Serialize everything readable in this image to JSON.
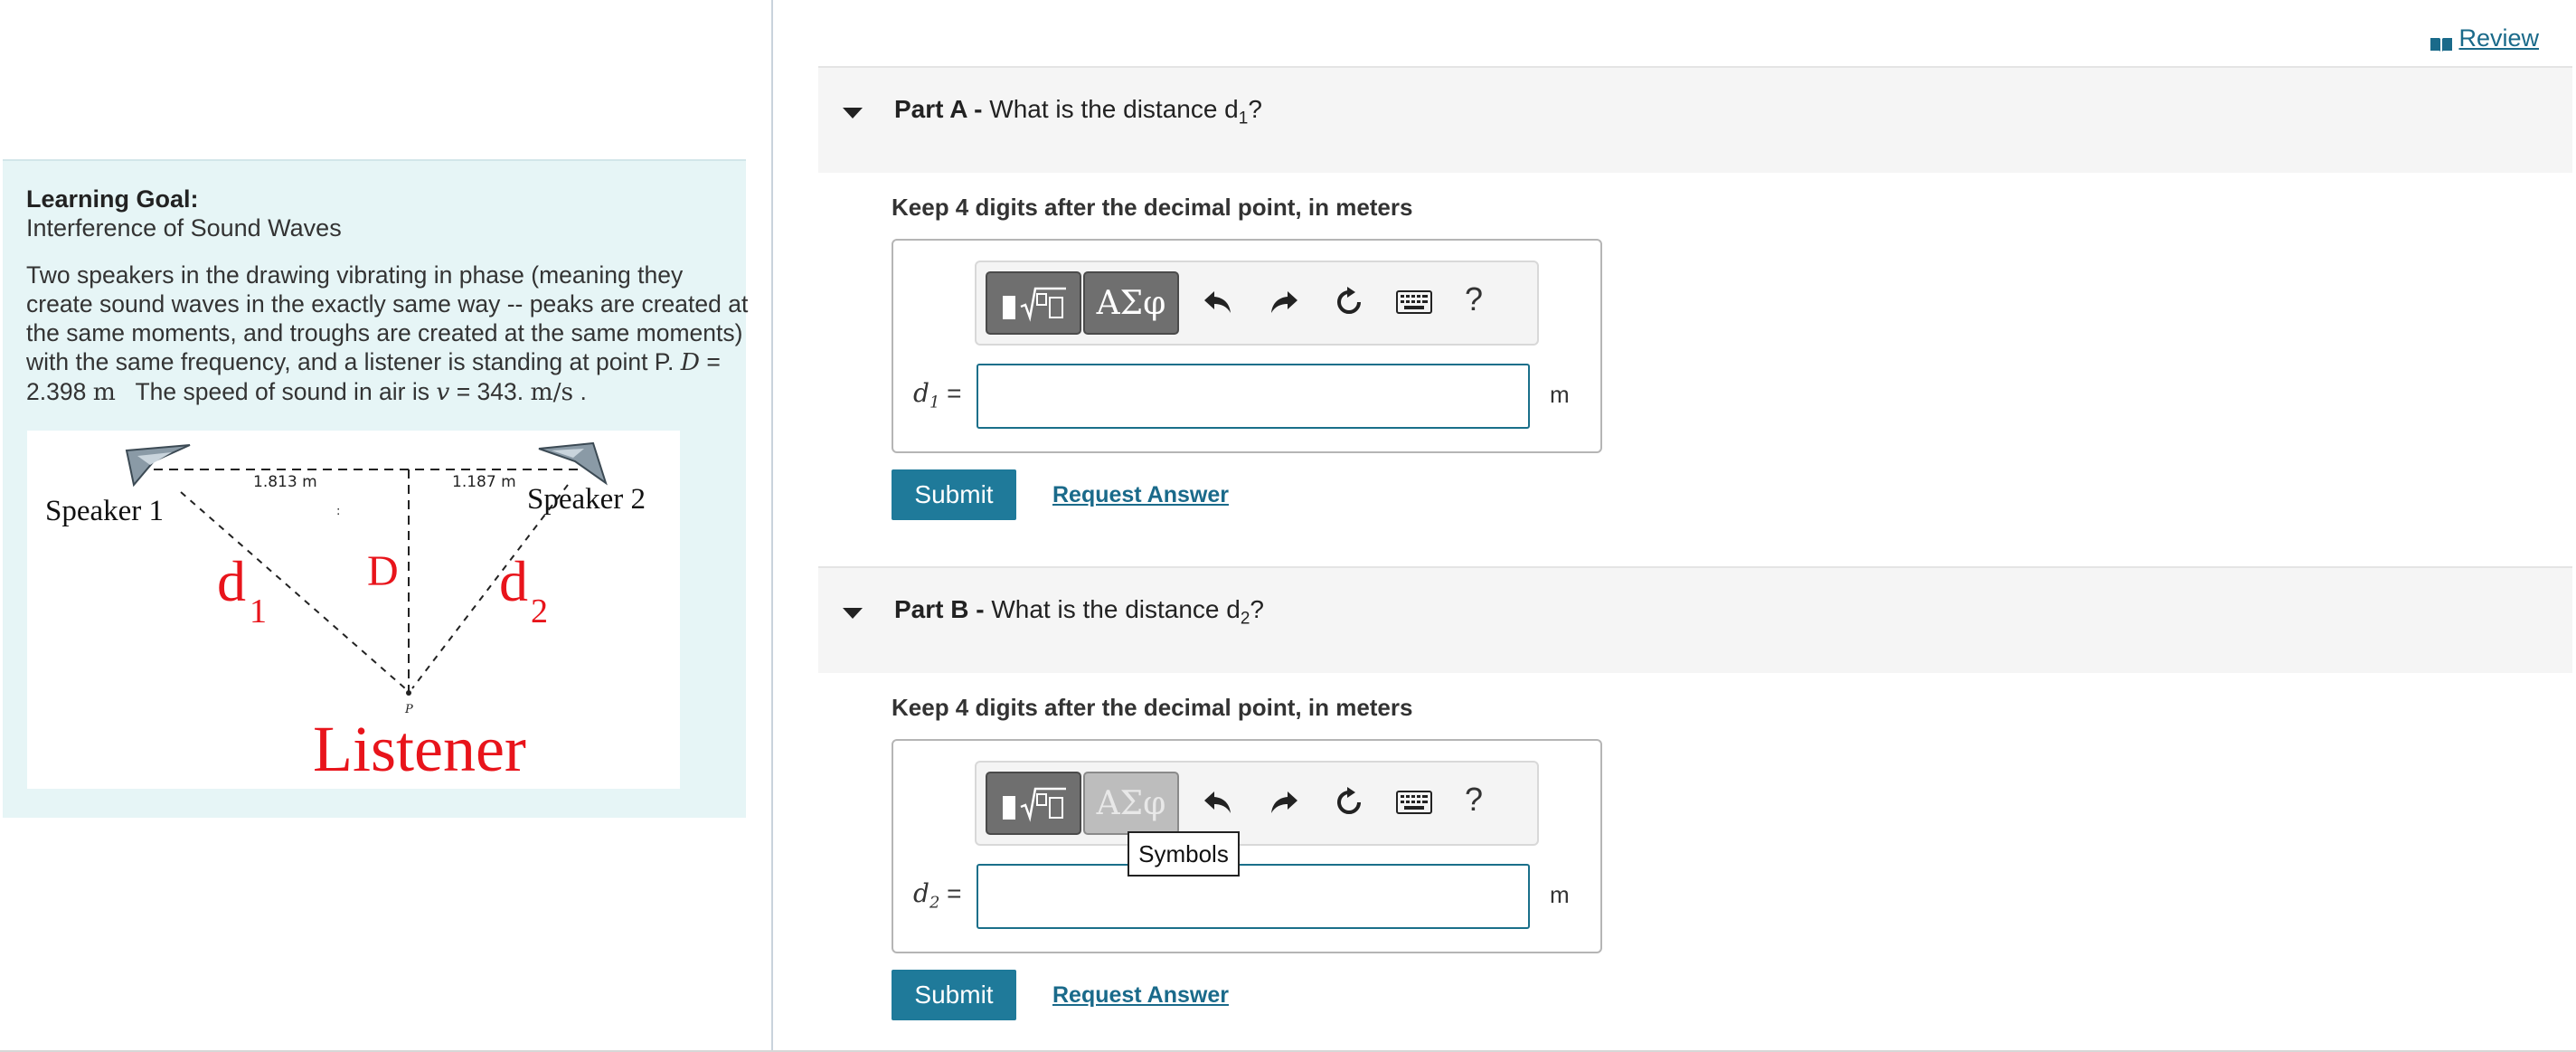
{
  "header": {
    "review_label": "Review"
  },
  "learning_goal": {
    "title": "Learning Goal:",
    "subtitle": "Interference of Sound Waves",
    "text_intro": "Two speakers in the drawing vibrating in phase (meaning they create sound waves in the exactly same way -- peaks are created at the same moments, and troughs are created at the same moments) with the same frequency, and a listener is standing at point P.",
    "D_symbol": "D",
    "D_eq": " = 2.398 ",
    "D_unit": "m",
    "speed_text": "The speed of sound in air is ",
    "v_symbol": "v",
    "v_eq": " = 343. ",
    "v_unit": "m/s",
    "end_period": " ."
  },
  "figure": {
    "speaker1": "Speaker 1",
    "speaker2": "Speaker 2",
    "dist_left": "1.813 m",
    "dist_right": "1.187 m",
    "label_d1": "d",
    "label_d1_sub": "1",
    "label_d2": "d",
    "label_d2_sub": "2",
    "label_D": "D",
    "label_P": "P",
    "listener": "Listener"
  },
  "part_a": {
    "label": "Part A -",
    "question_pre": "What is the distance d",
    "question_sub": "1",
    "question_post": "?",
    "instruction": "Keep 4 digits after the decimal point, in meters",
    "var": "d",
    "var_sub": "1",
    "eq": " =",
    "value": "",
    "unit": "m",
    "submit": "Submit",
    "request": "Request Answer"
  },
  "part_b": {
    "label": "Part B -",
    "question_pre": "What is the distance d",
    "question_sub": "2",
    "question_post": "?",
    "instruction": "Keep 4 digits after the decimal point, in meters",
    "var": "d",
    "var_sub": "2",
    "eq": " =",
    "value": "",
    "unit": "m",
    "submit": "Submit",
    "request": "Request Answer",
    "tooltip": "Symbols"
  },
  "toolbar": {
    "symbols_label": "ΑΣφ",
    "help_label": "?"
  },
  "colors": {
    "accent": "#1f7a9a",
    "figure_red": "#e8141b",
    "goal_bg": "#e6f5f6"
  }
}
